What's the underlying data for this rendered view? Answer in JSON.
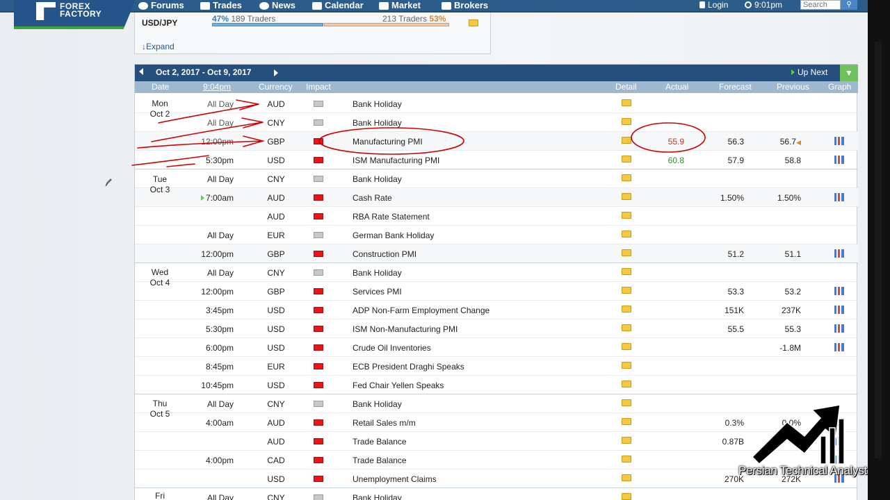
{
  "nav": {
    "logo_line1": "FOREX",
    "logo_line2": "FACTORY",
    "items": [
      "Forums",
      "Trades",
      "News",
      "Calendar",
      "Market",
      "Brokers"
    ],
    "login": "Login",
    "time": "9:01pm",
    "search_placeholder": "Search"
  },
  "sentiment": {
    "pair": "USD/JPY",
    "long_pct": "47%",
    "long_traders": "189 Traders",
    "short_traders": "213 Traders",
    "short_pct": "53%",
    "long_fraction": 0.47,
    "expand": "Expand"
  },
  "calendar": {
    "week_range": "Oct 2, 2017 - Oct 9, 2017",
    "up_next": "Up Next",
    "columns": {
      "date": "Date",
      "time": "9:04pm",
      "currency": "Currency",
      "impact": "Impact",
      "detail": "Detail",
      "actual": "Actual",
      "forecast": "Forecast",
      "previous": "Previous",
      "graph": "Graph"
    },
    "days": [
      {
        "day": "Mon",
        "date": "Oct 2"
      },
      {
        "day": "Tue",
        "date": "Oct 3"
      },
      {
        "day": "Wed",
        "date": "Oct 4"
      },
      {
        "day": "Thu",
        "date": "Oct 5"
      },
      {
        "day": "Fri",
        "date": ""
      }
    ],
    "rows": [
      {
        "time": "All Day",
        "currency": "AUD",
        "impact": "none",
        "event": "Bank Holiday",
        "actual": "",
        "forecast": "",
        "previous": "",
        "graph": false
      },
      {
        "time": "All Day",
        "currency": "CNY",
        "impact": "none",
        "event": "Bank Holiday",
        "actual": "",
        "forecast": "",
        "previous": "",
        "graph": false
      },
      {
        "time": "12:00pm",
        "currency": "GBP",
        "impact": "high",
        "event": "Manufacturing PMI",
        "actual": "55.9",
        "forecast": "56.3",
        "previous": "56.7",
        "graph": true
      },
      {
        "time": "5:30pm",
        "currency": "USD",
        "impact": "high",
        "event": "ISM Manufacturing PMI",
        "actual": "60.8",
        "forecast": "57.9",
        "previous": "58.8",
        "graph": true
      },
      {
        "time": "All Day",
        "currency": "CNY",
        "impact": "none",
        "event": "Bank Holiday",
        "actual": "",
        "forecast": "",
        "previous": "",
        "graph": false
      },
      {
        "time": "7:00am",
        "currency": "AUD",
        "impact": "high",
        "event": "Cash Rate",
        "actual": "",
        "forecast": "1.50%",
        "previous": "1.50%",
        "graph": true
      },
      {
        "time": "",
        "currency": "AUD",
        "impact": "high",
        "event": "RBA Rate Statement",
        "actual": "",
        "forecast": "",
        "previous": "",
        "graph": false
      },
      {
        "time": "All Day",
        "currency": "EUR",
        "impact": "none",
        "event": "German Bank Holiday",
        "actual": "",
        "forecast": "",
        "previous": "",
        "graph": false
      },
      {
        "time": "12:00pm",
        "currency": "GBP",
        "impact": "high",
        "event": "Construction PMI",
        "actual": "",
        "forecast": "51.2",
        "previous": "51.1",
        "graph": true
      },
      {
        "time": "All Day",
        "currency": "CNY",
        "impact": "none",
        "event": "Bank Holiday",
        "actual": "",
        "forecast": "",
        "previous": "",
        "graph": false
      },
      {
        "time": "12:00pm",
        "currency": "GBP",
        "impact": "high",
        "event": "Services PMI",
        "actual": "",
        "forecast": "53.3",
        "previous": "53.2",
        "graph": true
      },
      {
        "time": "3:45pm",
        "currency": "USD",
        "impact": "high",
        "event": "ADP Non-Farm Employment Change",
        "actual": "",
        "forecast": "151K",
        "previous": "237K",
        "graph": true
      },
      {
        "time": "5:30pm",
        "currency": "USD",
        "impact": "high",
        "event": "ISM Non-Manufacturing PMI",
        "actual": "",
        "forecast": "55.5",
        "previous": "55.3",
        "graph": true
      },
      {
        "time": "6:00pm",
        "currency": "USD",
        "impact": "high",
        "event": "Crude Oil Inventories",
        "actual": "",
        "forecast": "",
        "previous": "-1.8M",
        "graph": true
      },
      {
        "time": "8:45pm",
        "currency": "EUR",
        "impact": "high",
        "event": "ECB President Draghi Speaks",
        "actual": "",
        "forecast": "",
        "previous": "",
        "graph": false
      },
      {
        "time": "10:45pm",
        "currency": "USD",
        "impact": "high",
        "event": "Fed Chair Yellen Speaks",
        "actual": "",
        "forecast": "",
        "previous": "",
        "graph": false
      },
      {
        "time": "All Day",
        "currency": "CNY",
        "impact": "none",
        "event": "Bank Holiday",
        "actual": "",
        "forecast": "",
        "previous": "",
        "graph": false
      },
      {
        "time": "4:00am",
        "currency": "AUD",
        "impact": "high",
        "event": "Retail Sales m/m",
        "actual": "",
        "forecast": "0.3%",
        "previous": "0.0%",
        "graph": true
      },
      {
        "time": "",
        "currency": "AUD",
        "impact": "high",
        "event": "Trade Balance",
        "actual": "",
        "forecast": "0.87B",
        "previous": "",
        "graph": true
      },
      {
        "time": "4:00pm",
        "currency": "CAD",
        "impact": "high",
        "event": "Trade Balance",
        "actual": "",
        "forecast": "",
        "previous": "",
        "graph": true
      },
      {
        "time": "",
        "currency": "USD",
        "impact": "high",
        "event": "Unemployment Claims",
        "actual": "",
        "forecast": "270K",
        "previous": "272K",
        "graph": true
      },
      {
        "time": "All Day",
        "currency": "CNY",
        "impact": "none",
        "event": "Bank Holiday",
        "actual": "",
        "forecast": "",
        "previous": "",
        "graph": false
      }
    ]
  },
  "watermark": {
    "text": "Persian Technical Analyst"
  },
  "colors": {
    "nav": "#2c5c8a",
    "header": "#254f7c",
    "column_header": "#9eb8cf",
    "high_impact": "#e8151b",
    "annotation": "#d10000"
  }
}
